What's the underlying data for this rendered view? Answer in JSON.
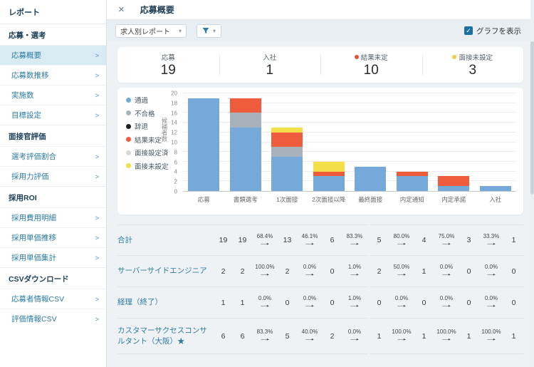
{
  "sidebar": {
    "title": "レポート",
    "sections": [
      {
        "header": "応募・選考",
        "items": [
          {
            "label": "応募概要",
            "selected": true
          },
          {
            "label": "応募数推移",
            "selected": false
          },
          {
            "label": "実施数",
            "selected": false
          },
          {
            "label": "目標設定",
            "selected": false
          }
        ]
      },
      {
        "header": "面接官評価",
        "items": [
          {
            "label": "選考評価割合",
            "selected": false
          },
          {
            "label": "採用力評価",
            "selected": false
          }
        ]
      },
      {
        "header": "採用ROI",
        "items": [
          {
            "label": "採用費用明細",
            "selected": false
          },
          {
            "label": "採用単価推移",
            "selected": false
          },
          {
            "label": "採用単価集計",
            "selected": false
          }
        ]
      },
      {
        "header": "CSVダウンロード",
        "items": [
          {
            "label": "応募者情報CSV",
            "selected": false
          },
          {
            "label": "評価情報CSV",
            "selected": false
          }
        ]
      }
    ]
  },
  "header": {
    "close_icon": "×",
    "title": "応募概要"
  },
  "toolbar": {
    "report_select": "求人別レポート",
    "graph_toggle_label": "グラフを表示",
    "graph_toggle_checked": true,
    "checkbox_color": "#1d6fa0",
    "check_glyph": "✓",
    "caret_glyph": "▾"
  },
  "stats": [
    {
      "label": "応募",
      "value": "19",
      "dot": null
    },
    {
      "label": "入社",
      "value": "1",
      "dot": null
    },
    {
      "label": "結果未定",
      "value": "10",
      "dot": "#e2523a"
    },
    {
      "label": "面接未設定",
      "value": "3",
      "dot": "#eccf4b"
    }
  ],
  "chart_data": {
    "type": "bar",
    "stacked": true,
    "categories": [
      "応募",
      "書類選考",
      "1次面接",
      "2次面接以降",
      "最終面接",
      "内定通知",
      "内定承諾",
      "入社"
    ],
    "series": [
      {
        "name": "通過",
        "color": "#75a9d9",
        "values": [
          19,
          13,
          7,
          3,
          5,
          3,
          1,
          1
        ]
      },
      {
        "name": "不合格",
        "color": "#a8b2ba",
        "values": [
          0,
          3,
          2,
          0,
          0,
          0,
          0,
          0
        ]
      },
      {
        "name": "辞退",
        "color": "#1e1e1e",
        "values": [
          0,
          0,
          0,
          0,
          0,
          0,
          0,
          0
        ]
      },
      {
        "name": "結果未定",
        "color": "#ee5c3d",
        "values": [
          0,
          3,
          3,
          1,
          0,
          1,
          2,
          0
        ]
      },
      {
        "name": "面接設定済",
        "color": "#d8d8d0",
        "values": [
          0,
          0,
          0,
          0,
          0,
          0,
          0,
          0
        ]
      },
      {
        "name": "面接未設定",
        "color": "#f5df49",
        "values": [
          0,
          0,
          1,
          2,
          0,
          0,
          0,
          0
        ]
      }
    ],
    "title": "",
    "xlabel": "",
    "ylabel": "候補者数",
    "ylim": [
      0,
      20
    ],
    "ytick_step": 2,
    "grid": true,
    "legend_position": "left"
  },
  "table": {
    "rows": [
      {
        "label": "合計",
        "counts": [
          "19",
          "19",
          "13",
          "6",
          "5",
          "4",
          "3",
          "1"
        ],
        "rates": [
          "68.4%",
          "46.1%",
          "83.3%",
          "80.0%",
          "75.0%",
          "33.3%"
        ]
      },
      {
        "label": "サーバーサイドエンジニア",
        "counts": [
          "2",
          "2",
          "2",
          "0",
          "2",
          "1",
          "0",
          "0"
        ],
        "rates": [
          "100.0%",
          "0.0%",
          "1.0%",
          "50.0%",
          "0.0%",
          "0.0%"
        ]
      },
      {
        "label": "経理（終了）",
        "counts": [
          "1",
          "1",
          "0",
          "0",
          "0",
          "0",
          "0",
          "0"
        ],
        "rates": [
          "0.0%",
          "0.0%",
          "1.0%",
          "0.0%",
          "0.0%",
          "0.0%"
        ]
      },
      {
        "label": "カスタマーサクセスコンサルタント（大阪）★",
        "counts": [
          "6",
          "6",
          "5",
          "2",
          "1",
          "1",
          "1",
          "1"
        ],
        "rates": [
          "83.3%",
          "40.0%",
          "0.0%",
          "100.0%",
          "100.0%",
          "100.0%"
        ]
      }
    ]
  }
}
